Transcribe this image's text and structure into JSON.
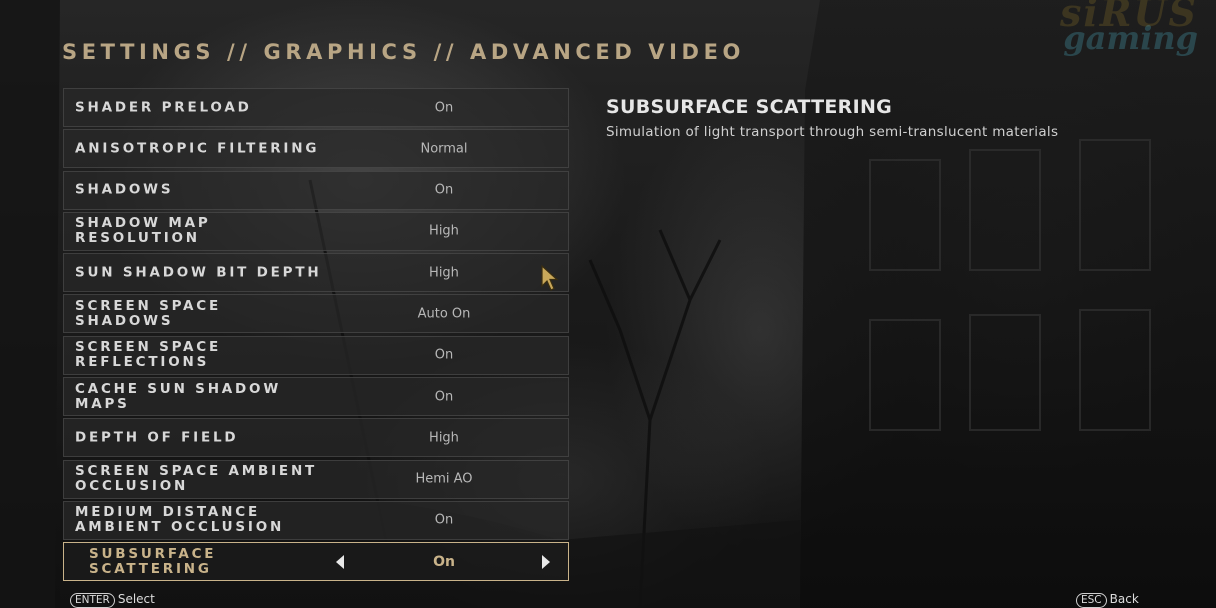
{
  "watermark": {
    "top": "siRUS",
    "bottom": "gaming"
  },
  "breadcrumb": "SETTINGS // GRAPHICS // ADVANCED VIDEO",
  "settings": [
    {
      "label": "SHADER PRELOAD",
      "value": "On"
    },
    {
      "label": "ANISOTROPIC FILTERING",
      "value": "Normal"
    },
    {
      "label": "SHADOWS",
      "value": "On"
    },
    {
      "label": "SHADOW MAP RESOLUTION",
      "value": "High"
    },
    {
      "label": "SUN SHADOW BIT DEPTH",
      "value": "High"
    },
    {
      "label": "SCREEN SPACE SHADOWS",
      "value": "Auto On"
    },
    {
      "label": "SCREEN SPACE REFLECTIONS",
      "value": "On"
    },
    {
      "label": "CACHE SUN SHADOW MAPS",
      "value": "On"
    },
    {
      "label": "DEPTH OF FIELD",
      "value": "High"
    },
    {
      "label": "SCREEN SPACE AMBIENT OCCLUSION",
      "value": "Hemi AO"
    },
    {
      "label": "MEDIUM DISTANCE AMBIENT OCCLUSION",
      "value": "On"
    },
    {
      "label": "SUBSURFACE SCATTERING",
      "value": "On",
      "selected": true
    }
  ],
  "description": {
    "title": "SUBSURFACE SCATTERING",
    "text": "Simulation of light transport through semi-translucent materials"
  },
  "hints": {
    "select_key": "ENTER",
    "select_label": "Select",
    "back_key": "ESC",
    "back_label": "Back"
  },
  "colors": {
    "accent": "#c9b38a",
    "row_bg": "#282828",
    "text": "#d8d8d8"
  }
}
